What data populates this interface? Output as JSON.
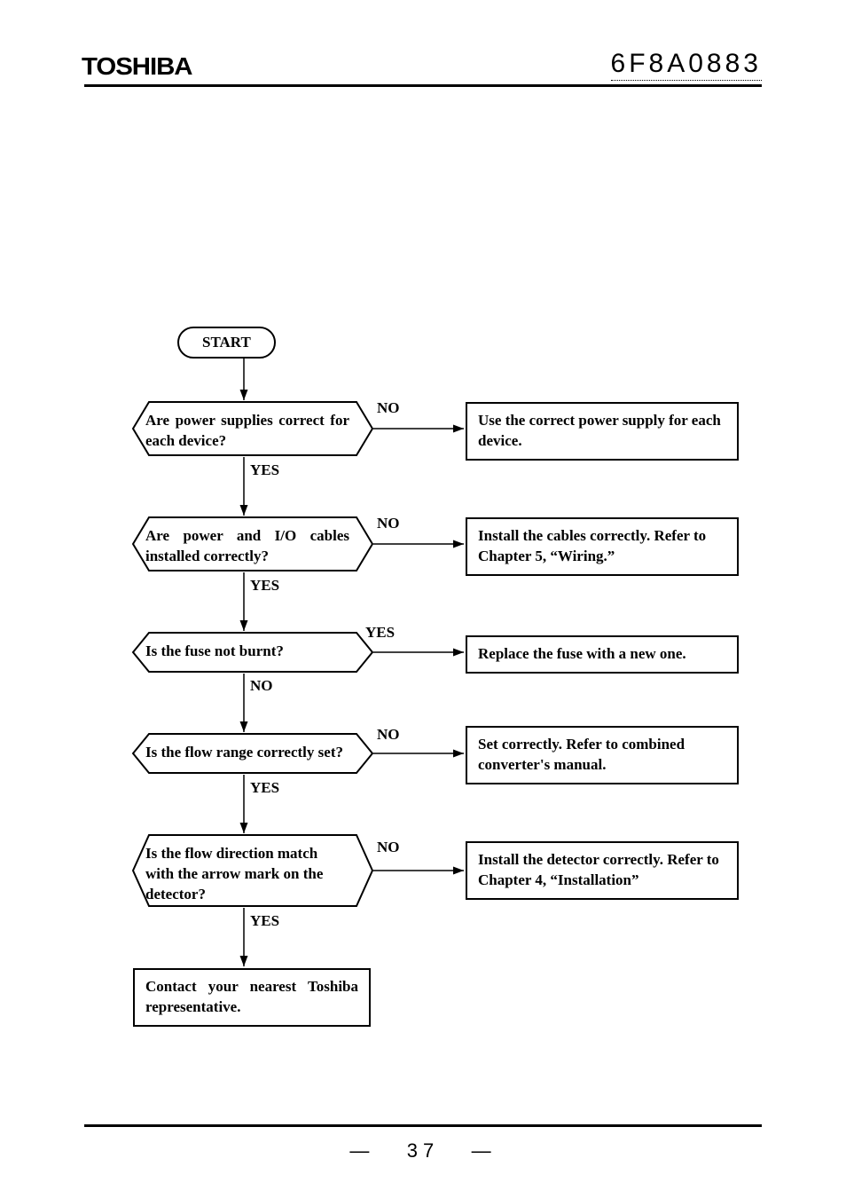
{
  "header": {
    "brand": "TOSHIBA",
    "doc_id": "6F8A0883"
  },
  "flowchart": {
    "start": "START",
    "d1": {
      "q": "Are power supplies correct for each device?",
      "yes": "YES",
      "no": "NO",
      "action": "Use the correct power supply for each device."
    },
    "d2": {
      "q": "Are power and I/O cables installed correctly?",
      "yes": "YES",
      "no": "NO",
      "action": "Install the cables correctly.\nRefer to Chapter 5, “Wiring.”"
    },
    "d3": {
      "q": "Is the fuse not burnt?",
      "yes": "YES",
      "no": "NO",
      "action": "Replace the fuse with a new one."
    },
    "d4": {
      "q": "Is the flow range correctly set?",
      "yes": "YES",
      "no": "NO",
      "action": "Set correctly.\nRefer to combined converter's manual."
    },
    "d5": {
      "q": "Is the flow direction match with the arrow mark on the detector?",
      "yes": "YES",
      "no": "NO",
      "action": "Install the detector correctly.\nRefer to Chapter 4, “Installation”"
    },
    "end": "Contact your nearest Toshiba representative."
  },
  "footer": {
    "page": "—   37   —"
  }
}
